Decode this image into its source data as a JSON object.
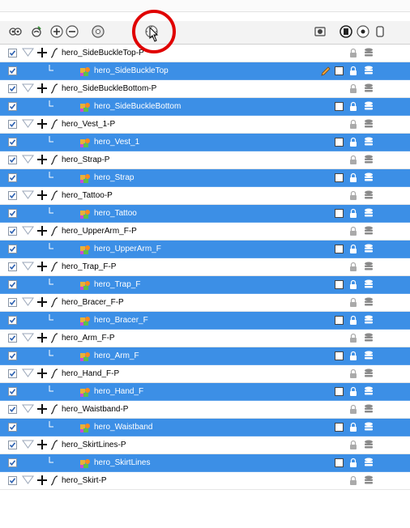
{
  "layers": [
    {
      "name": "hero_SideBuckleTop-P",
      "kind": "peg"
    },
    {
      "name": "hero_SideBuckleTop",
      "kind": "drawing",
      "editing": true
    },
    {
      "name": "hero_SideBuckleBottom-P",
      "kind": "peg"
    },
    {
      "name": "hero_SideBuckleBottom",
      "kind": "drawing"
    },
    {
      "name": "hero_Vest_1-P",
      "kind": "peg"
    },
    {
      "name": "hero_Vest_1",
      "kind": "drawing"
    },
    {
      "name": "hero_Strap-P",
      "kind": "peg"
    },
    {
      "name": "hero_Strap",
      "kind": "drawing"
    },
    {
      "name": "hero_Tattoo-P",
      "kind": "peg"
    },
    {
      "name": "hero_Tattoo",
      "kind": "drawing"
    },
    {
      "name": "hero_UpperArm_F-P",
      "kind": "peg"
    },
    {
      "name": "hero_UpperArm_F",
      "kind": "drawing"
    },
    {
      "name": "hero_Trap_F-P",
      "kind": "peg"
    },
    {
      "name": "hero_Trap_F",
      "kind": "drawing"
    },
    {
      "name": "hero_Bracer_F-P",
      "kind": "peg"
    },
    {
      "name": "hero_Bracer_F",
      "kind": "drawing"
    },
    {
      "name": "hero_Arm_F-P",
      "kind": "peg"
    },
    {
      "name": "hero_Arm_F",
      "kind": "drawing"
    },
    {
      "name": "hero_Hand_F-P",
      "kind": "peg"
    },
    {
      "name": "hero_Hand_F",
      "kind": "drawing"
    },
    {
      "name": "hero_Waistband-P",
      "kind": "peg"
    },
    {
      "name": "hero_Waistband",
      "kind": "drawing"
    },
    {
      "name": "hero_SkirtLines-P",
      "kind": "peg"
    },
    {
      "name": "hero_SkirtLines",
      "kind": "drawing"
    },
    {
      "name": "hero_Skirt-P",
      "kind": "peg"
    }
  ],
  "colors": {
    "selected_row": "#3c8fe6",
    "highlight_circle": "#e00000",
    "checkbox_check": "#2a5fb0"
  },
  "toolbar_icons": [
    "show-all-icon",
    "hide-all-icon",
    "add-layer-icon",
    "remove-layer-icon",
    "add-peg-icon",
    "layer-properties-icon",
    "enable-all-icon",
    "display-toggle-icon",
    "record-icon",
    "lock-all-icon"
  ]
}
